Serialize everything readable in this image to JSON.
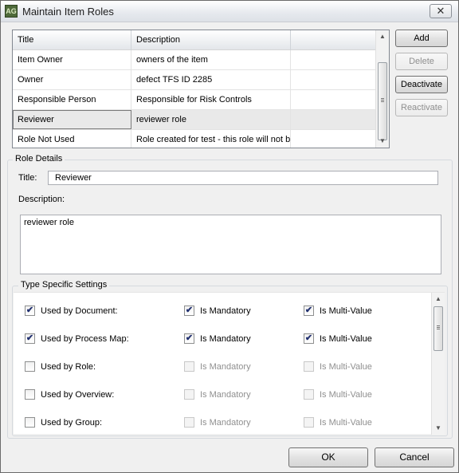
{
  "window": {
    "title": "Maintain Item Roles",
    "app_icon": "app-logo-icon",
    "close_symbol": "✕"
  },
  "roles_table": {
    "columns": [
      "Title",
      "Description",
      ""
    ],
    "rows": [
      {
        "title": "Item Owner",
        "description": "owners of the item",
        "extra": ""
      },
      {
        "title": "Owner",
        "description": "defect TFS ID 2285",
        "extra": ""
      },
      {
        "title": "Responsible Person",
        "description": "Responsible for Risk Controls",
        "extra": ""
      },
      {
        "title": "Reviewer",
        "description": "reviewer role",
        "extra": ""
      },
      {
        "title": "Role Not Used",
        "description": "Role created for test - this role will not be used",
        "extra": ""
      }
    ],
    "selected_row": 3,
    "scroll_up_icon": "▲",
    "scroll_down_icon": "▼"
  },
  "actions": {
    "add": "Add",
    "delete": "Delete",
    "deactivate": "Deactivate",
    "reactivate": "Reactivate"
  },
  "role_details": {
    "legend": "Role Details",
    "title_label": "Title:",
    "title_value": "Reviewer",
    "description_label": "Description:",
    "description_value": "reviewer role"
  },
  "type_settings": {
    "legend": "Type Specific Settings",
    "rows": [
      {
        "label": "Used by Document:",
        "used": true,
        "mandatory_label": "Is Mandatory",
        "mandatory": true,
        "mandatory_enabled": true,
        "multi_label": "Is Multi-Value",
        "multi": true,
        "multi_enabled": true
      },
      {
        "label": "Used by Process Map:",
        "used": true,
        "mandatory_label": "Is Mandatory",
        "mandatory": true,
        "mandatory_enabled": true,
        "multi_label": "Is Multi-Value",
        "multi": true,
        "multi_enabled": true
      },
      {
        "label": "Used by Role:",
        "used": false,
        "mandatory_label": "Is Mandatory",
        "mandatory": false,
        "mandatory_enabled": false,
        "multi_label": "Is Multi-Value",
        "multi": false,
        "multi_enabled": false
      },
      {
        "label": "Used by Overview:",
        "used": false,
        "mandatory_label": "Is Mandatory",
        "mandatory": false,
        "mandatory_enabled": false,
        "multi_label": "Is Multi-Value",
        "multi": false,
        "multi_enabled": false
      },
      {
        "label": "Used by Group:",
        "used": false,
        "mandatory_label": "Is Mandatory",
        "mandatory": false,
        "mandatory_enabled": false,
        "multi_label": "Is Multi-Value",
        "multi": false,
        "multi_enabled": false
      }
    ],
    "check_symbol": "✔"
  },
  "footer": {
    "ok": "OK",
    "cancel": "Cancel"
  }
}
